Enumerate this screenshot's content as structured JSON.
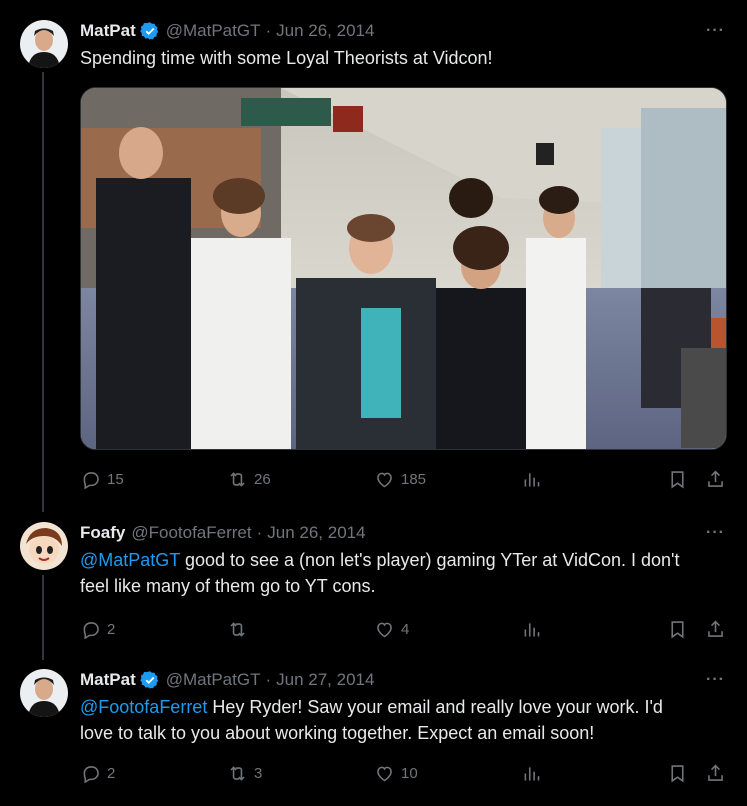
{
  "tweets": [
    {
      "name": "MatPat",
      "verified": true,
      "handle": "@MatPatGT",
      "date": "Jun 26, 2014",
      "text": "Spending time with some Loyal Theorists at Vidcon!",
      "replies": "15",
      "retweets": "26",
      "likes": "185"
    },
    {
      "name": "Foafy",
      "verified": false,
      "handle": "@FootofaFerret",
      "date": "Jun 26, 2014",
      "mention": "@MatPatGT",
      "text_line1": " good to see a (non let's player) gaming YTer at VidCon. I don't",
      "text_line2": "feel like many of them go to YT cons.",
      "replies": "2",
      "retweets": "",
      "likes": "4"
    },
    {
      "name": "MatPat",
      "verified": true,
      "handle": "@MatPatGT",
      "date": "Jun 27, 2014",
      "mention": "@FootofaFerret",
      "text_line1": " Hey Ryder! Saw your email and really love your work. I'd",
      "text_line2": "love to talk to you about working together. Expect an email soon!",
      "replies": "2",
      "retweets": "3",
      "likes": "10"
    }
  ],
  "separator": "·",
  "more_glyph": "···",
  "icons": {
    "reply": "reply-icon",
    "retweet": "retweet-icon",
    "like": "heart-icon",
    "views": "views-chart-icon",
    "bookmark": "bookmark-icon",
    "share": "share-icon",
    "verified": "verified-badge-icon"
  },
  "colors": {
    "background": "#000000",
    "text": "#e7e9ea",
    "muted": "#71767b",
    "link": "#1d9bf0",
    "verified": "#1d9bf0"
  }
}
